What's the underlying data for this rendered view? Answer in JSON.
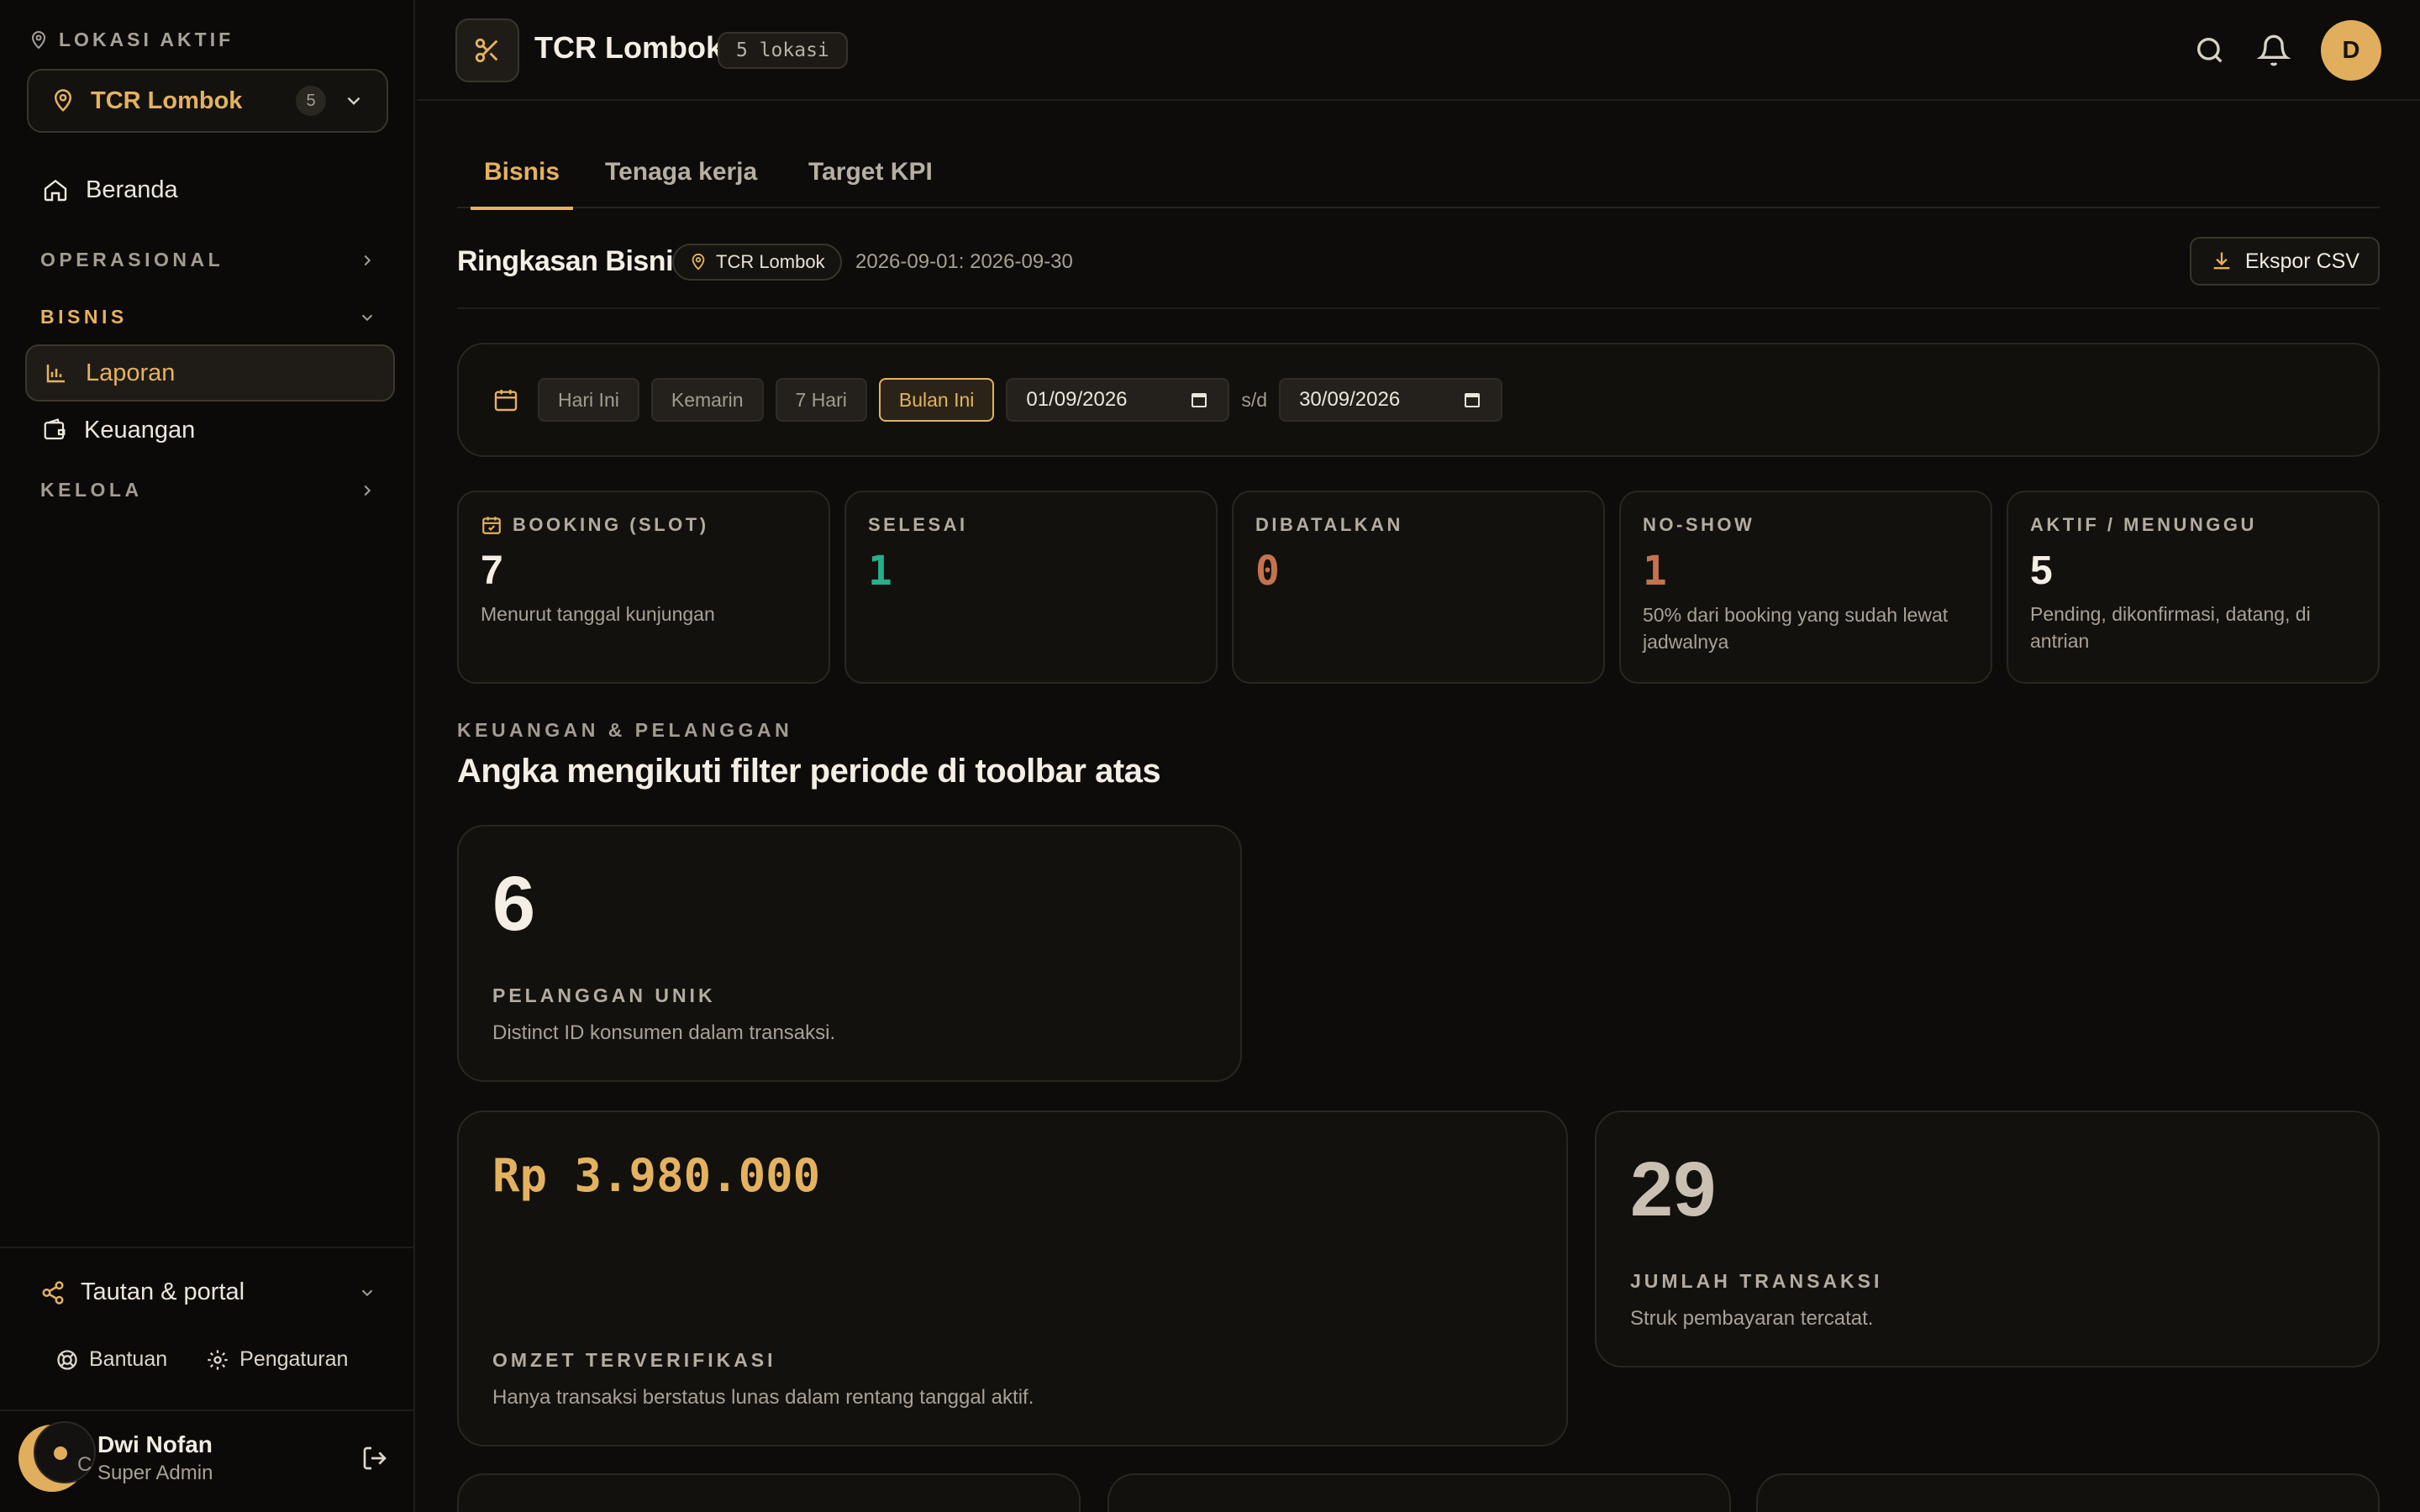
{
  "sidebar": {
    "active_location_label": "LOKASI AKTIF",
    "location": {
      "name": "TCR Lombok",
      "count": "5"
    },
    "items": {
      "home": "Beranda",
      "operasional": "OPERASIONAL",
      "bisnis": "BISNIS",
      "laporan": "Laporan",
      "keuangan": "Keuangan",
      "kelola": "KELOLA"
    },
    "portal": "Tautan & portal",
    "help": "Bantuan",
    "settings": "Pengaturan",
    "user": {
      "name": "Dwi Nofan",
      "role": "Super Admin",
      "avatar_fragment": "C"
    }
  },
  "topbar": {
    "brand": "TCR Lombok",
    "locations_pill": "5 lokasi",
    "avatar_initial": "D"
  },
  "tabs": [
    "Bisnis",
    "Tenaga kerja",
    "Target KPI"
  ],
  "summary": {
    "title": "Ringkasan Bisnis",
    "location": "TCR Lombok",
    "range": "2026-09-01: 2026-09-30",
    "export_label": "Ekspor CSV"
  },
  "filters": {
    "chips": [
      "Hari Ini",
      "Kemarin",
      "7 Hari",
      "Bulan Ini"
    ],
    "active_chip": "Bulan Ini",
    "from": "01/09/2026",
    "separator": "s/d",
    "to": "30/09/2026"
  },
  "stats": [
    {
      "label": "BOOKING (SLOT)",
      "value": "7",
      "desc": "Menurut tanggal kunjungan",
      "color": "#f4eee4"
    },
    {
      "label": "SELESAI",
      "value": "1",
      "desc": "",
      "color": "#27b08a"
    },
    {
      "label": "DIBATALKAN",
      "value": "0",
      "desc": "",
      "color": "#c5734f"
    },
    {
      "label": "NO-SHOW",
      "value": "1",
      "desc": "50% dari booking yang sudah lewat jadwalnya",
      "color": "#c5734f"
    },
    {
      "label": "AKTIF / MENUNGGU",
      "value": "5",
      "desc": "Pending, dikonfirmasi, datang, di antrian",
      "color": "#f4eee4"
    }
  ],
  "finance": {
    "kicker": "KEUANGAN & PELANGGAN",
    "title": "Angka mengikuti filter periode di toolbar atas",
    "unique_customers": {
      "value": "6",
      "label": "PELANGGAN UNIK",
      "desc": "Distinct ID konsumen dalam transaksi."
    },
    "revenue": {
      "value": "Rp 3.980.000",
      "label": "OMZET TERVERIFIKASI",
      "desc": "Hanya transaksi berstatus lunas dalam rentang tanggal aktif."
    },
    "transactions": {
      "value": "29",
      "label": "JUMLAH TRANSAKSI",
      "desc": "Struk pembayaran tercatat."
    }
  },
  "colors": {
    "accent": "#e4b25e",
    "success": "#27b08a",
    "danger": "#c5734f"
  }
}
